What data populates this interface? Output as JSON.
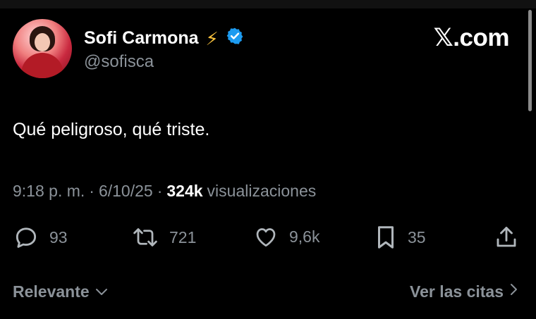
{
  "author": {
    "name": "Sofi Carmona",
    "handle": "@sofisca"
  },
  "site": "𝕏.com",
  "tweet": {
    "text": "Qué peligroso, qué triste."
  },
  "meta": {
    "time": "9:18 p. m.",
    "separator": "·",
    "date": "6/10/25",
    "views_count": "324k",
    "views_label": "visualizaciones"
  },
  "actions": {
    "replies": "93",
    "reposts": "721",
    "likes": "9,6k",
    "bookmarks": "35"
  },
  "footer": {
    "sort_label": "Relevante",
    "quotes_label": "Ver las citas"
  },
  "colors": {
    "background": "#000000",
    "text": "#ffffff",
    "muted": "#8b9299",
    "verified": "#1d9bf0",
    "bolt": "#f9c23c"
  }
}
